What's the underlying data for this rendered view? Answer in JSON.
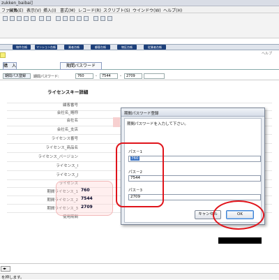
{
  "window": {
    "title": "zukken_baibai]"
  },
  "menu": {
    "items": [
      "ファイル",
      "編集(E)",
      "表示(V)",
      "挿入(I)",
      "書式(M)",
      "レコード(R)",
      "スクリプト(S)",
      "ウインドウ(W)",
      "ヘルプ(H)"
    ]
  },
  "nav_tabs": [
    "物件台帳",
    "マンション台帳",
    "業者台帳",
    "顧客台帳",
    "物区台帳",
    "従業者台帳"
  ],
  "help_label": "ヘルプ",
  "tabs": {
    "input": "購　入",
    "period_password": "期間パスワード"
  },
  "field_row": {
    "button": "期間パス登録",
    "label": "期間パスワード:",
    "values": [
      "760",
      "7544",
      "2709"
    ],
    "separators": [
      "-",
      "-"
    ]
  },
  "detail": {
    "title": "ライセンスキー詳細",
    "labels": [
      "顧客番号",
      "会社名_略称",
      "会社名",
      "会社名_支店",
      "ライセンス番号",
      "ライセンス_商品名",
      "ライセンス_バージョン",
      "ライセンス_I",
      "ライセンス_J",
      "ライセンス",
      "期間ライセンス_1",
      "期間ライセンス_2",
      "期間ライセンス_3",
      "使用期間"
    ],
    "values": {
      "p1": "760",
      "p2": "7544",
      "p3": "2709"
    }
  },
  "dialog": {
    "title": "期間パスワード登録",
    "message": "期間パスワードを入力して下さい。",
    "fields": [
      {
        "label": "パス－1",
        "value": "760"
      },
      {
        "label": "パス－2",
        "value": "7544"
      },
      {
        "label": "パス－3",
        "value": "2709"
      }
    ],
    "cancel_label": "キャンセル",
    "ok_label": "OK"
  },
  "status": {
    "text": "を押します。"
  },
  "colors": {
    "navy": "#1c3f7a",
    "annotation_red": "#e0141b",
    "highlight_pink": "#f2b8b8"
  }
}
